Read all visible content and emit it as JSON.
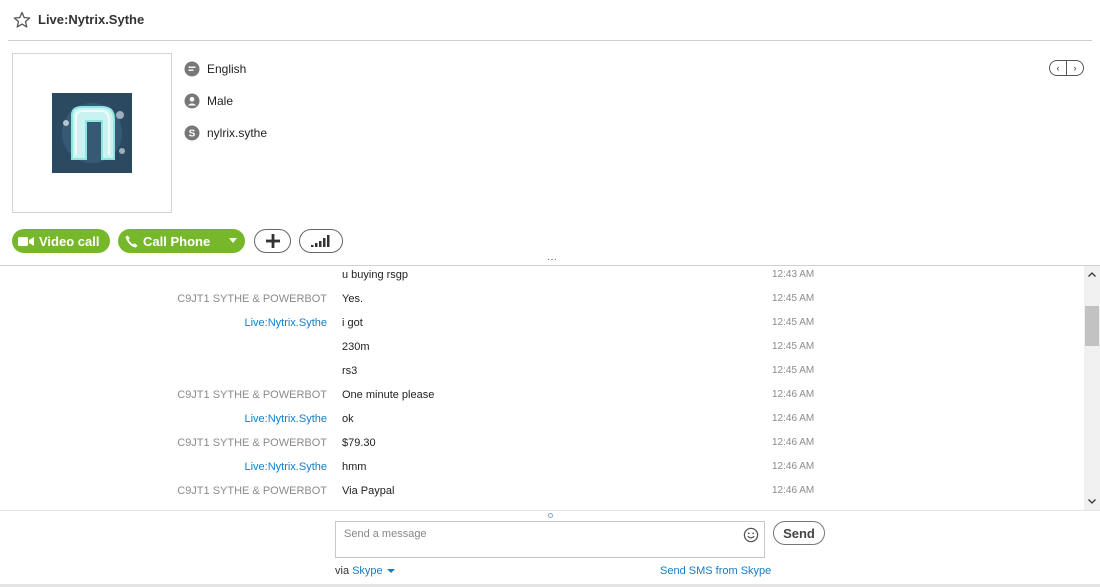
{
  "contact": {
    "name": "Live:Nytrix.Sythe",
    "language": "English",
    "gender": "Male",
    "skype_name": "nylrix.sythe"
  },
  "actions": {
    "video_call_label": "Video call",
    "call_phone_label": "Call Phone",
    "accent_color": "#77b82a"
  },
  "chat": {
    "messages": [
      {
        "sender": "",
        "text": "u buying rsgp",
        "time": "12:43 AM",
        "self": false
      },
      {
        "sender": "C9JT1 SYTHE & POWERBOT",
        "text": "Yes.",
        "time": "12:45 AM",
        "self": false
      },
      {
        "sender": "Live:Nytrix.Sythe",
        "text": "i got",
        "time": "12:45 AM",
        "self": true
      },
      {
        "sender": "",
        "text": "230m",
        "time": "12:45 AM",
        "self": true
      },
      {
        "sender": "",
        "text": "rs3",
        "time": "12:45 AM",
        "self": true
      },
      {
        "sender": "C9JT1 SYTHE & POWERBOT",
        "text": "One minute please",
        "time": "12:46 AM",
        "self": false
      },
      {
        "sender": "Live:Nytrix.Sythe",
        "text": "ok",
        "time": "12:46 AM",
        "self": true
      },
      {
        "sender": "C9JT1 SYTHE & POWERBOT",
        "text": "$79.30",
        "time": "12:46 AM",
        "self": false
      },
      {
        "sender": "Live:Nytrix.Sythe",
        "text": "hmm",
        "time": "12:46 AM",
        "self": true
      },
      {
        "sender": "C9JT1 SYTHE & POWERBOT",
        "text": "Via Paypal",
        "time": "12:46 AM",
        "self": false
      }
    ]
  },
  "composer": {
    "placeholder": "Send a message",
    "send_label": "Send",
    "via_label": "via",
    "via_service": "Skype",
    "sms_link": "Send SMS from Skype"
  },
  "colors": {
    "link": "#1a7bc0",
    "sender_other": "#8a8a8a"
  }
}
